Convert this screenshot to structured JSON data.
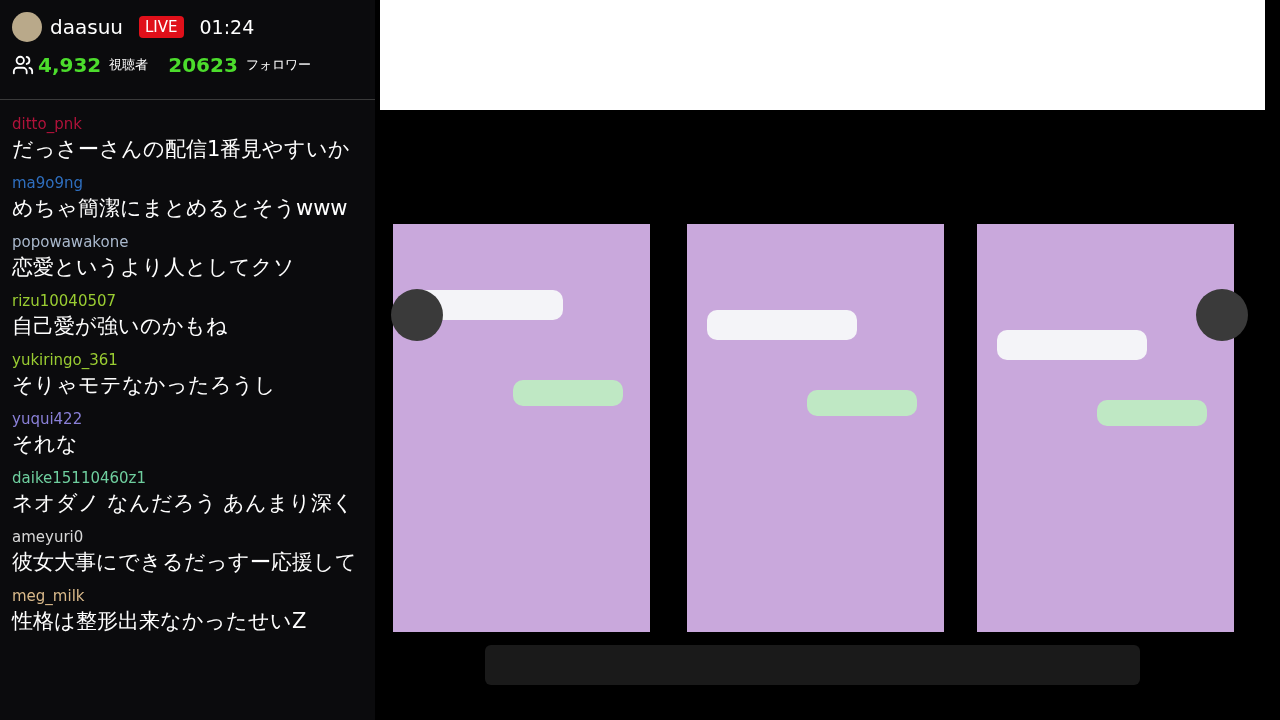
{
  "channel": {
    "name": "daasuu",
    "live_badge": "LIVE",
    "uptime": "01:24",
    "viewers": "4,932",
    "viewers_label": "視聴者",
    "followers": "20623",
    "followers_label": "フォロワー"
  },
  "chat": [
    {
      "user": "ditto_pnk",
      "color": "#b0123a",
      "message": "だっさーさんの配信1番見やすいか"
    },
    {
      "user": "ma9o9ng",
      "color": "#2f6fbf",
      "message": "めちゃ簡潔にまとめるとそうwww"
    },
    {
      "user": "popowawakone",
      "color": "#a9b8cc",
      "message": "恋愛というより人としてクソ"
    },
    {
      "user": "rizu10040507",
      "color": "#9acd32",
      "message": "自己愛が強いのかもね"
    },
    {
      "user": "yukiringo_361",
      "color": "#9acd32",
      "message": "そりゃモテなかったろうし"
    },
    {
      "user": "yuqui422",
      "color": "#8a80d8",
      "message": "それな"
    },
    {
      "user": "daike15110460z1",
      "color": "#6fcf9f",
      "message": "ネオダノ なんだろう あんまり深く"
    },
    {
      "user": "ameyuri0",
      "color": "#d8d8d8",
      "message": "彼女大事にできるだっすー応援して"
    },
    {
      "user": "meg_milk",
      "color": "#d9b98a",
      "message": "性格は整形出来なかったせいZ"
    }
  ]
}
